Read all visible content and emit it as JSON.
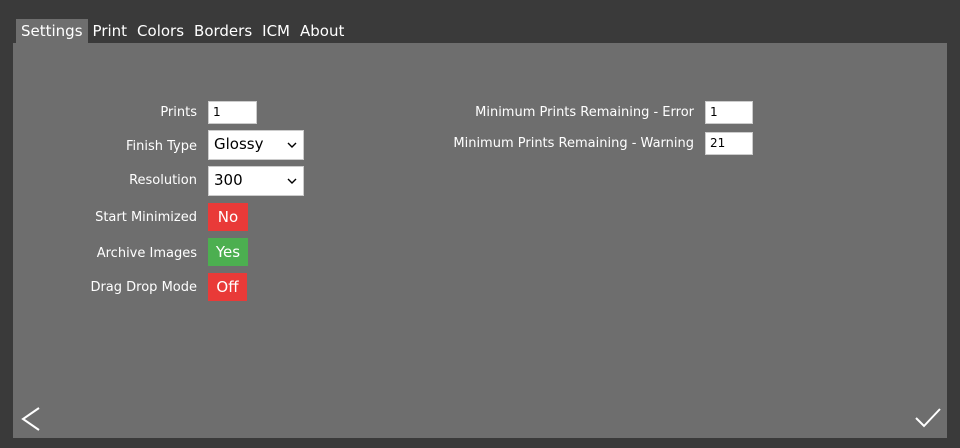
{
  "tabs": [
    {
      "label": "Settings",
      "active": true
    },
    {
      "label": "Print",
      "active": false
    },
    {
      "label": "Colors",
      "active": false
    },
    {
      "label": "Borders",
      "active": false
    },
    {
      "label": "ICM",
      "active": false
    },
    {
      "label": "About",
      "active": false
    }
  ],
  "settings": {
    "prints": {
      "label": "Prints",
      "value": "1"
    },
    "finish_type": {
      "label": "Finish Type",
      "value": "Glossy"
    },
    "resolution": {
      "label": "Resolution",
      "value": "300"
    },
    "start_minimized": {
      "label": "Start Minimized",
      "value": "No"
    },
    "archive_images": {
      "label": "Archive Images",
      "value": "Yes"
    },
    "drag_drop_mode": {
      "label": "Drag Drop Mode",
      "value": "Off"
    },
    "min_prints_error": {
      "label": "Minimum Prints Remaining - Error",
      "value": "1"
    },
    "min_prints_warning": {
      "label": "Minimum Prints Remaining - Warning",
      "value": "21"
    }
  },
  "colors": {
    "background": "#3a3a3a",
    "panel": "#6e6e6e",
    "toggle_off": "#e93a38",
    "toggle_on": "#4caf50"
  },
  "icons": {
    "back": "chevron-left-icon",
    "confirm": "checkmark-icon"
  }
}
